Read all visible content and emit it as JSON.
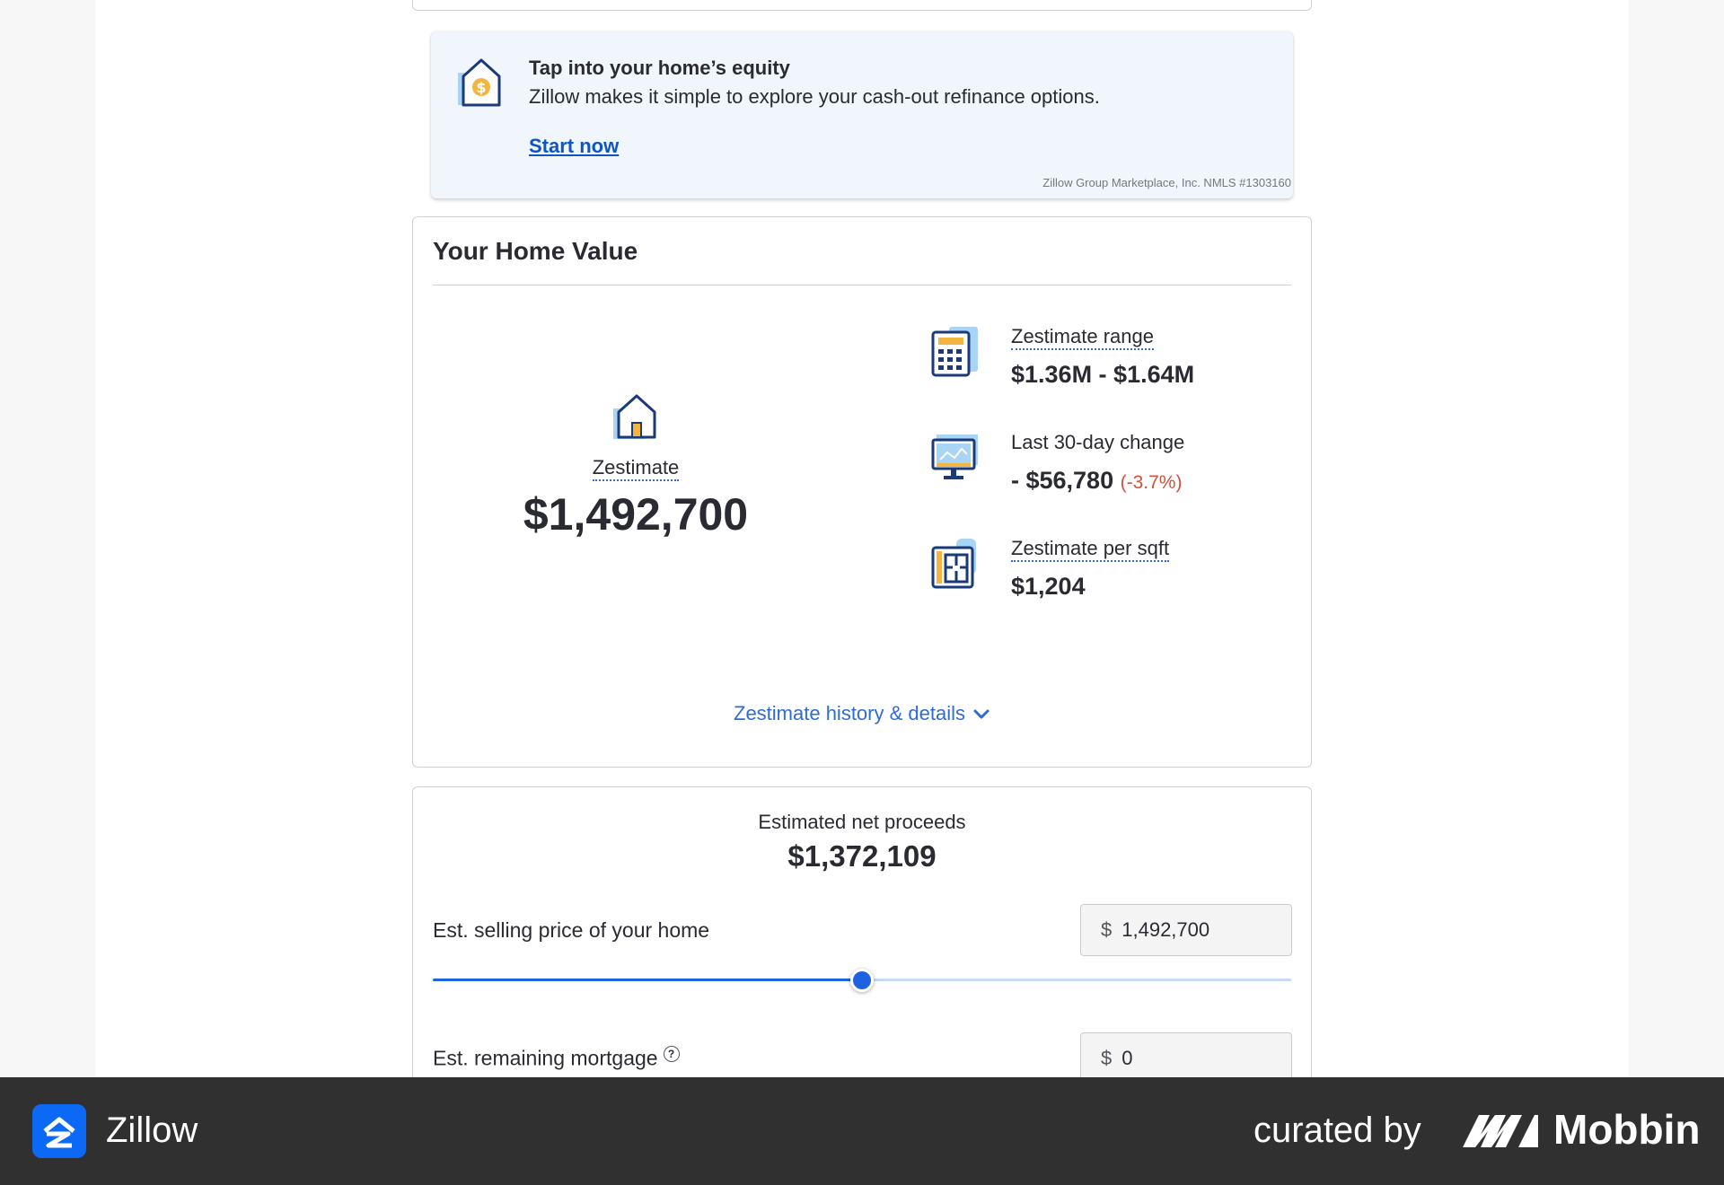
{
  "promo": {
    "title": "Tap into your home’s equity",
    "description": "Zillow makes it simple to explore your cash-out refinance options.",
    "cta": "Start now",
    "legal": "Zillow Group Marketplace, Inc. NMLS #1303160"
  },
  "home_value": {
    "title": "Your Home Value",
    "zestimate_label": "Zestimate",
    "zestimate_value": "$1,492,700",
    "stats": [
      {
        "label": "Zestimate range",
        "value": "$1.36M - $1.64M",
        "icon": "calculator-icon"
      },
      {
        "label": "Last 30-day change",
        "value": "- $56,780",
        "change": "(-3.7%)",
        "icon": "monitor-chart-icon"
      },
      {
        "label": "Zestimate per sqft",
        "value": "$1,204",
        "icon": "floorplan-icon"
      }
    ],
    "history_link": "Zestimate history & details"
  },
  "proceeds": {
    "label": "Estimated net proceeds",
    "value": "$1,372,109",
    "selling_price_label": "Est. selling price of your home",
    "currency": "$",
    "selling_price_value": "1,492,700",
    "slider_fraction": 0.5,
    "mortgage_label": "Est. remaining mortgage",
    "mortgage_help": "?",
    "mortgage_value": "0"
  },
  "footer": {
    "app_name": "Zillow",
    "curated_by": "curated by",
    "brand": "Mobbin"
  },
  "colors": {
    "accent": "#1f62e0",
    "link": "#0d55c6",
    "negative": "#d4503c",
    "footer_bg": "#303031"
  }
}
